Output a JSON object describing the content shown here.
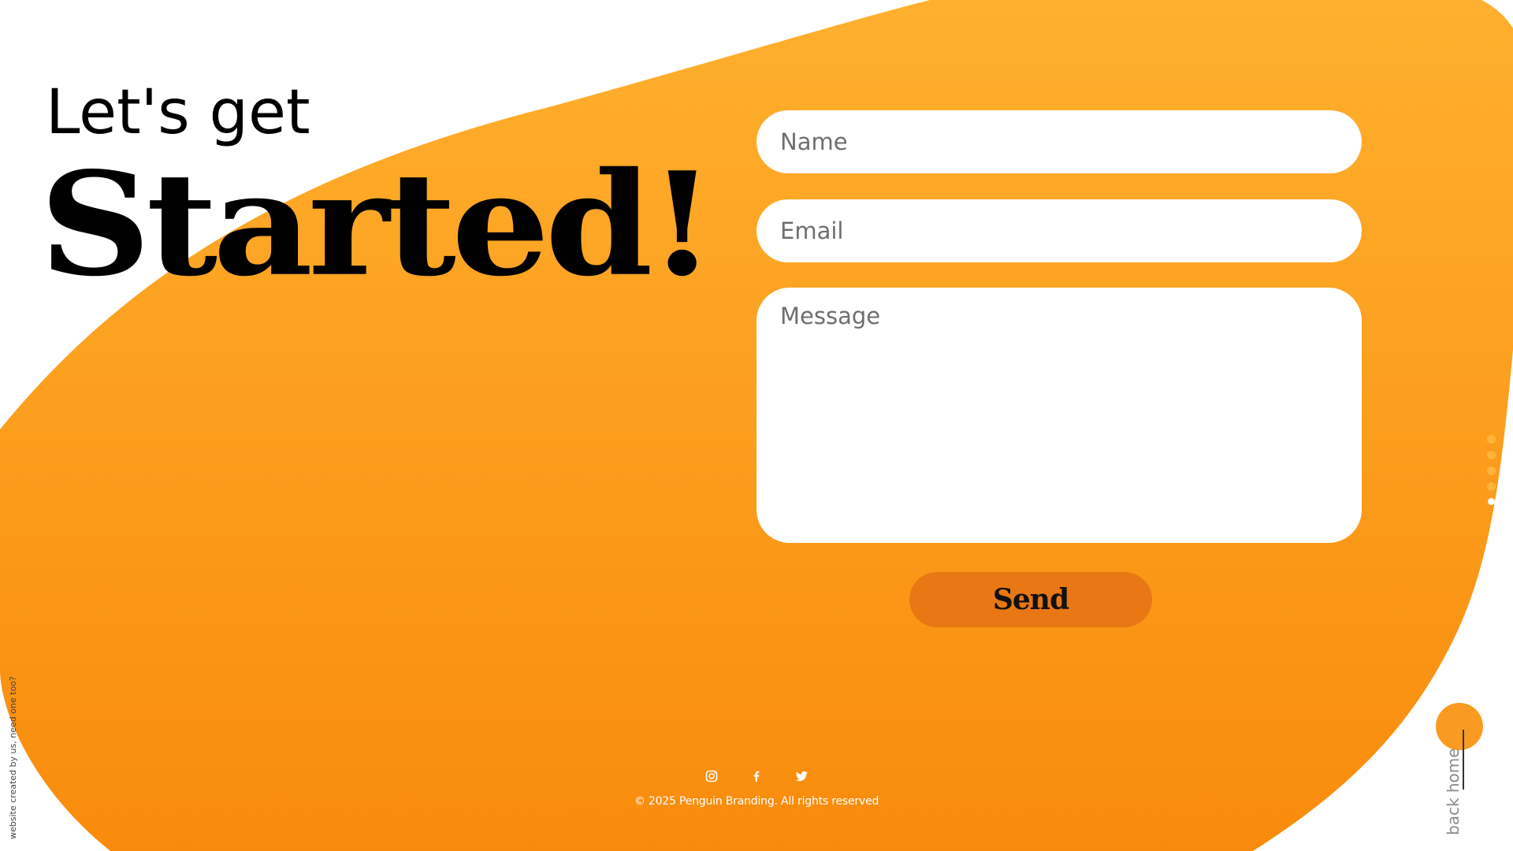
{
  "hero": {
    "line1": "Let's get",
    "line2": "Started!"
  },
  "form": {
    "name_placeholder": "Name",
    "email_placeholder": "Email",
    "message_placeholder": "Message",
    "send_label": "Send"
  },
  "section_nav": {
    "count": 5,
    "active_index": 4
  },
  "sidebar": {
    "credit_text": "website created by us, need one too?"
  },
  "back_home": {
    "label": "back home"
  },
  "footer": {
    "social_icons": [
      "instagram-icon",
      "facebook-icon",
      "twitter-icon"
    ],
    "copyright": "© 2025 Penguin Branding. All rights reserved"
  },
  "colors": {
    "accent_orange": "#f99b20",
    "accent_light": "#ffb43a",
    "send_button": "#e87714",
    "background": "#ffffff"
  }
}
